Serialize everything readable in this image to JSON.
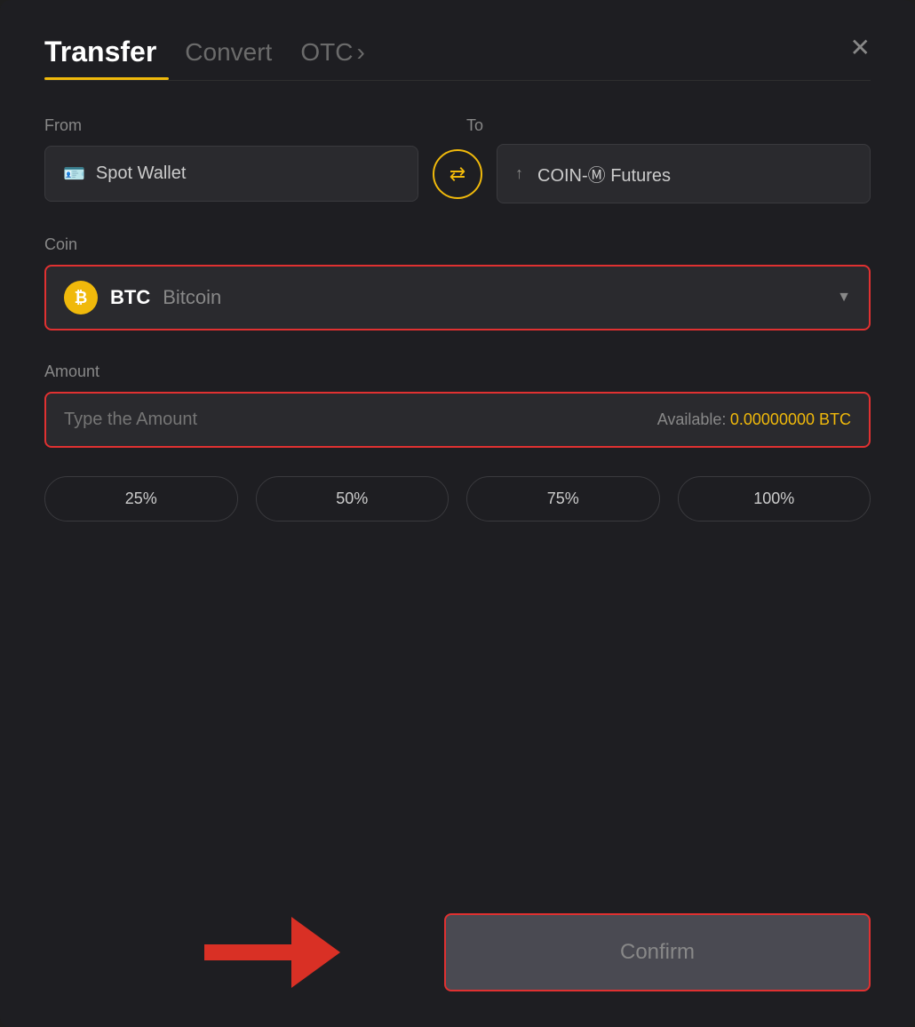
{
  "header": {
    "tab_transfer": "Transfer",
    "tab_convert": "Convert",
    "tab_otc": "OTC",
    "tab_otc_arrow": "›",
    "close_label": "✕"
  },
  "from": {
    "label": "From",
    "wallet_name": "Spot Wallet"
  },
  "to": {
    "label": "To",
    "wallet_name": "COIN-Ⓜ Futures"
  },
  "coin": {
    "label": "Coin",
    "symbol": "BTC",
    "name": "Bitcoin"
  },
  "amount": {
    "label": "Amount",
    "placeholder": "Type the Amount",
    "available_label": "Available:",
    "available_value": "0.00000000 BTC"
  },
  "percent_buttons": [
    "25%",
    "50%",
    "75%",
    "100%"
  ],
  "confirm_button": "Confirm"
}
